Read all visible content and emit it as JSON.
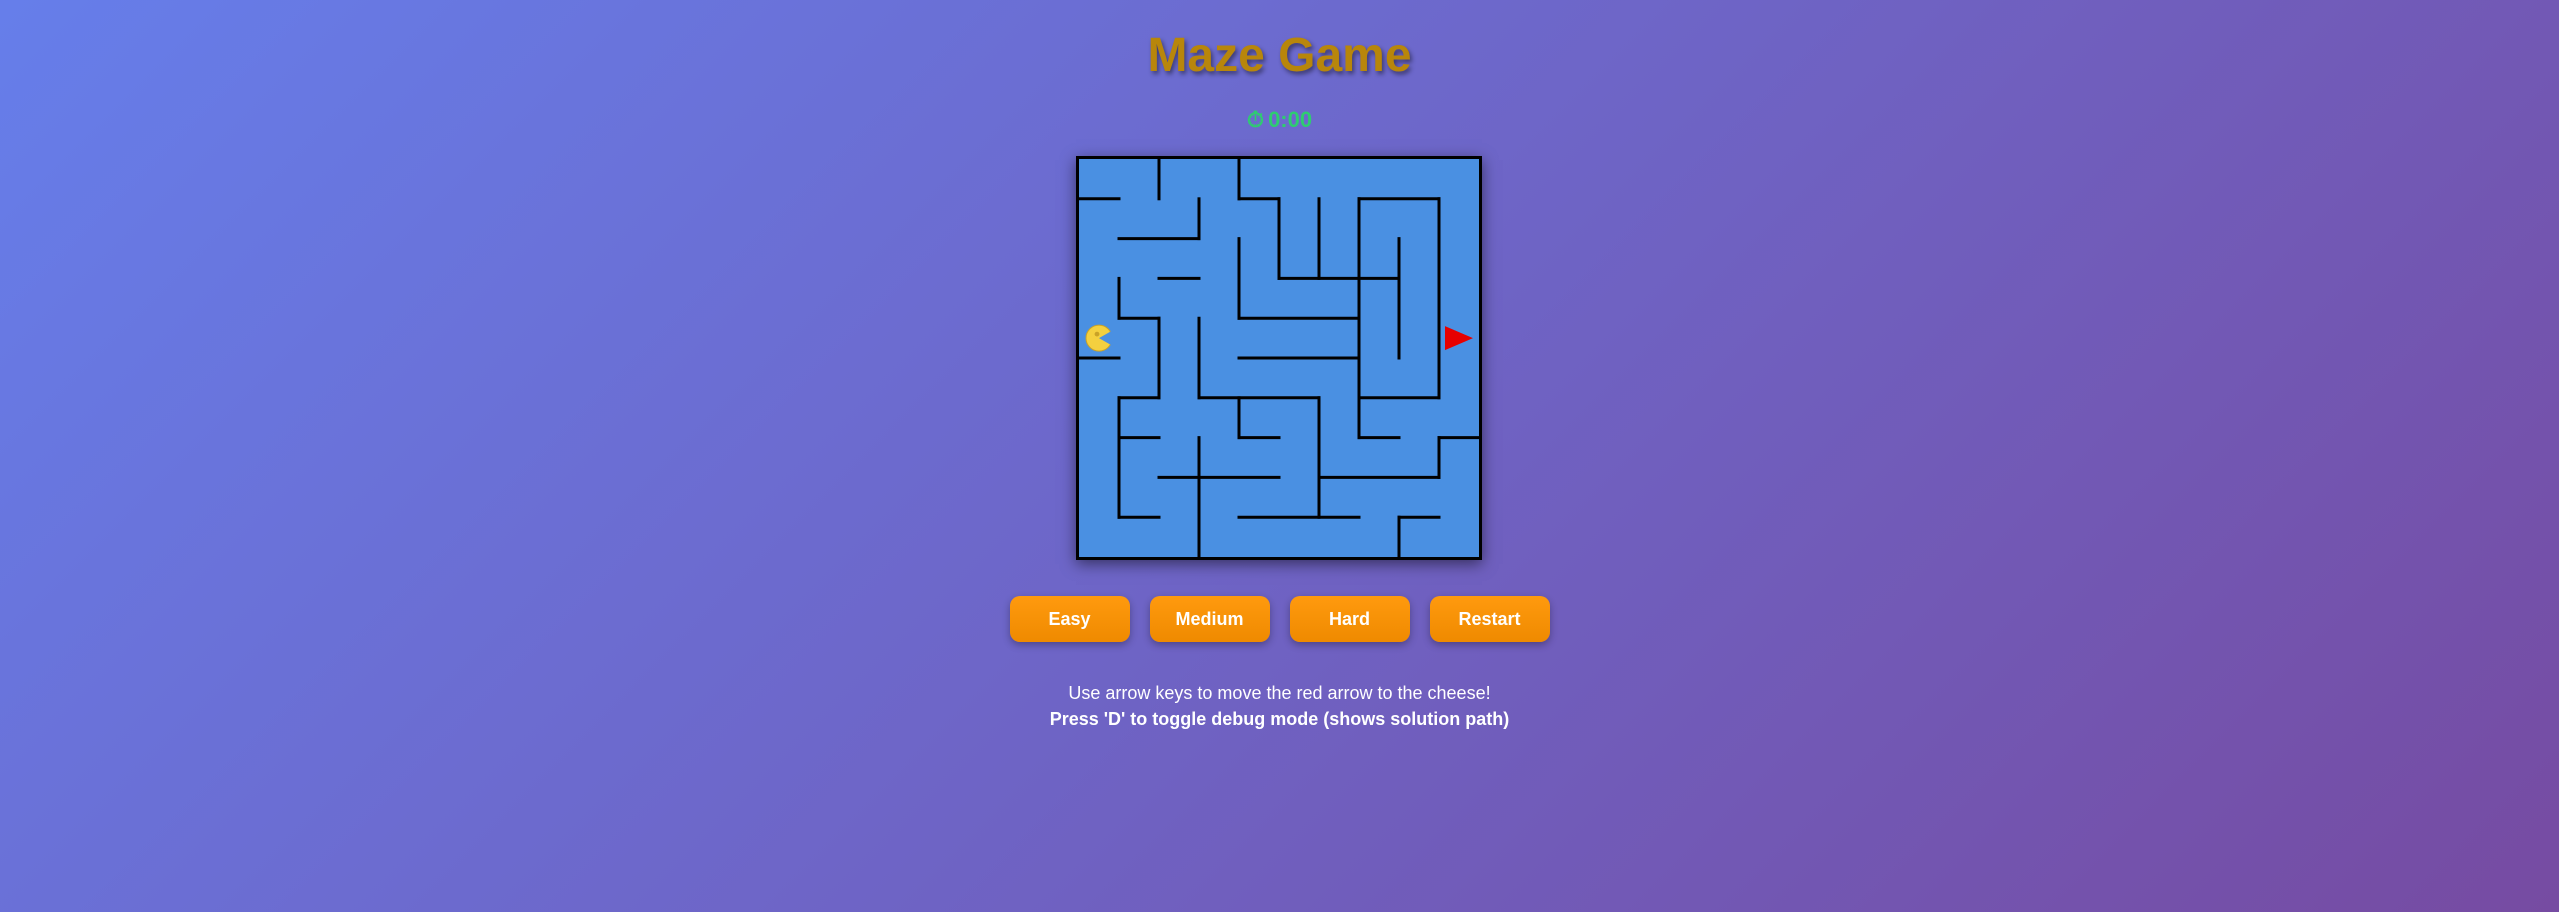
{
  "title": "Maze Game",
  "timer": {
    "icon": "stopwatch-icon",
    "icon_glyph": "⏱",
    "value": "0:00"
  },
  "maze": {
    "rows": 10,
    "cols": 10,
    "background_color": "#4a90e2",
    "wall_color": "#000000",
    "player": {
      "row": 4,
      "col": 9,
      "direction": "left",
      "color": "#e60000"
    },
    "goal": {
      "row": 4,
      "col": 0,
      "item": "cheese",
      "color": "#f4d03f"
    },
    "walls_h": [
      [
        1,
        0,
        1
      ],
      [
        2,
        1,
        3
      ],
      [
        3,
        2,
        3
      ],
      [
        4,
        1,
        2
      ],
      [
        4,
        4,
        7
      ],
      [
        5,
        0,
        1
      ],
      [
        5,
        4,
        7
      ],
      [
        6,
        1,
        2
      ],
      [
        6,
        3,
        6
      ],
      [
        6,
        7,
        9
      ],
      [
        7,
        1,
        2
      ],
      [
        7,
        4,
        5
      ],
      [
        7,
        7,
        8
      ],
      [
        7,
        9,
        10
      ],
      [
        8,
        2,
        5
      ],
      [
        8,
        6,
        9
      ],
      [
        9,
        1,
        2
      ],
      [
        9,
        4,
        7
      ],
      [
        9,
        8,
        9
      ],
      [
        1,
        4,
        5
      ],
      [
        1,
        7,
        9
      ],
      [
        3,
        5,
        8
      ]
    ],
    "walls_v": [
      [
        2,
        0,
        1
      ],
      [
        4,
        0,
        1
      ],
      [
        3,
        1,
        2
      ],
      [
        5,
        1,
        3
      ],
      [
        6,
        1,
        3
      ],
      [
        7,
        1,
        6
      ],
      [
        9,
        1,
        6
      ],
      [
        8,
        2,
        5
      ],
      [
        4,
        2,
        4
      ],
      [
        1,
        3,
        4
      ],
      [
        2,
        4,
        6
      ],
      [
        3,
        4,
        6
      ],
      [
        4,
        6,
        7
      ],
      [
        6,
        6,
        9
      ],
      [
        7,
        6,
        7
      ],
      [
        1,
        6,
        9
      ],
      [
        3,
        7,
        10
      ],
      [
        9,
        7,
        8
      ],
      [
        8,
        9,
        10
      ]
    ]
  },
  "buttons": {
    "easy": "Easy",
    "medium": "Medium",
    "hard": "Hard",
    "restart": "Restart"
  },
  "instructions": {
    "line1": "Use arrow keys to move the red arrow to the cheese!",
    "line2": "Press 'D' to toggle debug mode (shows solution path)"
  }
}
